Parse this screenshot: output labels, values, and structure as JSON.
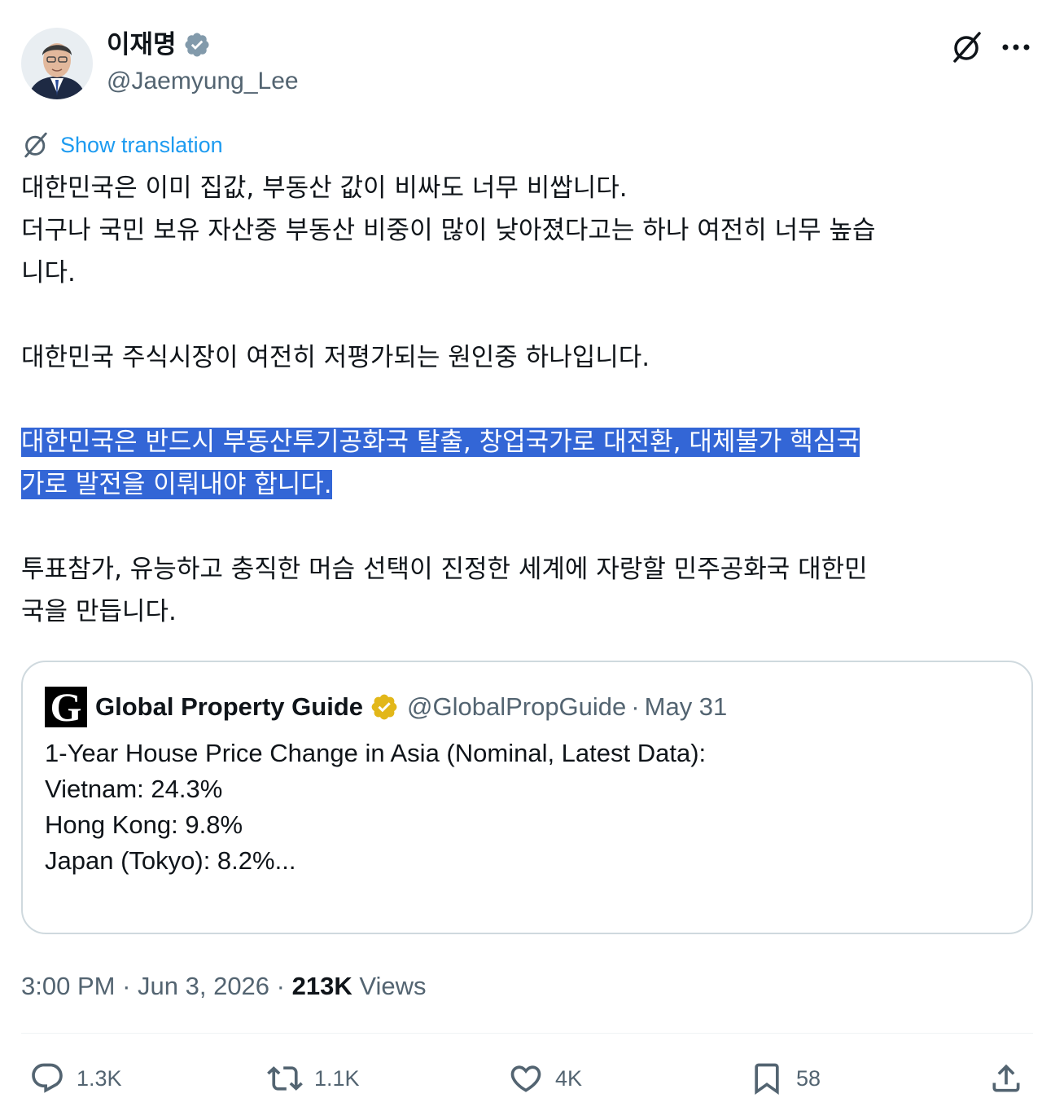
{
  "author": {
    "display_name": "이재명",
    "handle": "@Jaemyung_Lee"
  },
  "translate_label": "Show translation",
  "paragraphs": [
    "대한민국은 이미 집값, 부동산 값이 비싸도 너무 비쌉니다.\n더구나 국민 보유 자산중 부동산 비중이 많이 낮아졌다고는 하나 여전히 너무 높습\n니다.",
    "대한민국 주식시장이 여전히 저평가되는 원인중 하나입니다.",
    "대한민국은 반드시 부동산투기공화국 탈출, 창업국가로 대전환, 대체불가 핵심국\n가로 발전을 이뤄내야 합니다.",
    "투표참가, 유능하고 충직한 머슴 선택이 진정한 세계에 자랑할 민주공화국 대한민\n국을 만듭니다."
  ],
  "quote": {
    "logo_letter": "G",
    "name": "Global Property Guide",
    "handle": "@GlobalPropGuide",
    "separator": "·",
    "date": "May 31",
    "lines": [
      "1-Year House Price Change in Asia (Nominal, Latest Data):",
      "",
      "Vietnam: 24.3%",
      "Hong Kong: 9.8%",
      "Japan (Tokyo): 8.2%..."
    ]
  },
  "meta": {
    "time": "3:00 PM",
    "sep1": " · ",
    "date": "Jun 3, 2026",
    "sep2": " · ",
    "views_count": "213K",
    "views_label": " Views"
  },
  "actions": {
    "replies": "1.3K",
    "reposts": "1.1K",
    "likes": "4K",
    "bookmarks": "58"
  },
  "colors": {
    "accent": "#1d9bf0",
    "highlight": "#3366d6",
    "gold_badge": "#e2b719",
    "muted": "#536471"
  }
}
